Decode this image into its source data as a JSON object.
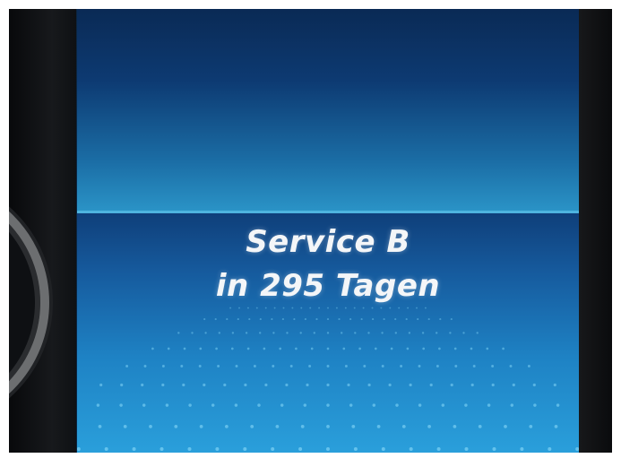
{
  "display": {
    "service_label": "Service B",
    "due_text": "in 295 Tagen"
  },
  "colors": {
    "screen_top": "#0d3a72",
    "screen_bottom": "#1e82c4",
    "text": "#f4f6f8",
    "bezel": "#0c0e12"
  }
}
